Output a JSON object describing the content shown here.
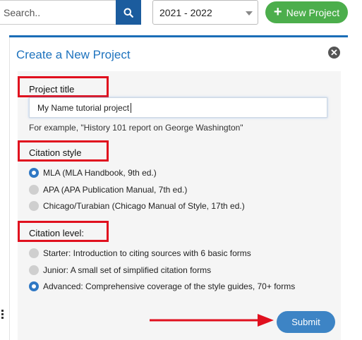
{
  "toolbar": {
    "search_placeholder": "Search..",
    "search_icon": "search-icon",
    "year_selected": "2021 - 2022",
    "new_project_label": "New Project",
    "new_project_icon": "plus-icon",
    "new_project_color": "#4cae4c",
    "search_button_color": "#1b5c9e"
  },
  "panel": {
    "title": "Create a New Project",
    "close_icon": "close-icon",
    "accent_color": "#1e73be"
  },
  "form": {
    "project_title_label": "Project title",
    "project_title_value": "My Name tutorial project",
    "project_title_hint": "For example, \"History 101 report on George Washington\"",
    "citation_style_label": "Citation style",
    "citation_styles": [
      {
        "label": "MLA (MLA Handbook, 9th ed.)",
        "selected": true
      },
      {
        "label": "APA (APA Publication Manual, 7th ed.)",
        "selected": false
      },
      {
        "label": "Chicago/Turabian (Chicago Manual of Style, 17th ed.)",
        "selected": false
      }
    ],
    "citation_level_label": "Citation level:",
    "citation_levels": [
      {
        "label": "Starter: Introduction to citing sources with 6 basic forms",
        "selected": false
      },
      {
        "label": "Junior: A small set of simplified citation forms",
        "selected": false
      },
      {
        "label": "Advanced: Comprehensive coverage of the style guides, 70+ forms",
        "selected": true
      }
    ],
    "submit_label": "Submit",
    "submit_color": "#3d84c5"
  },
  "annotations": {
    "highlight_color": "#e0101e",
    "arrow_color": "#e0101e"
  }
}
